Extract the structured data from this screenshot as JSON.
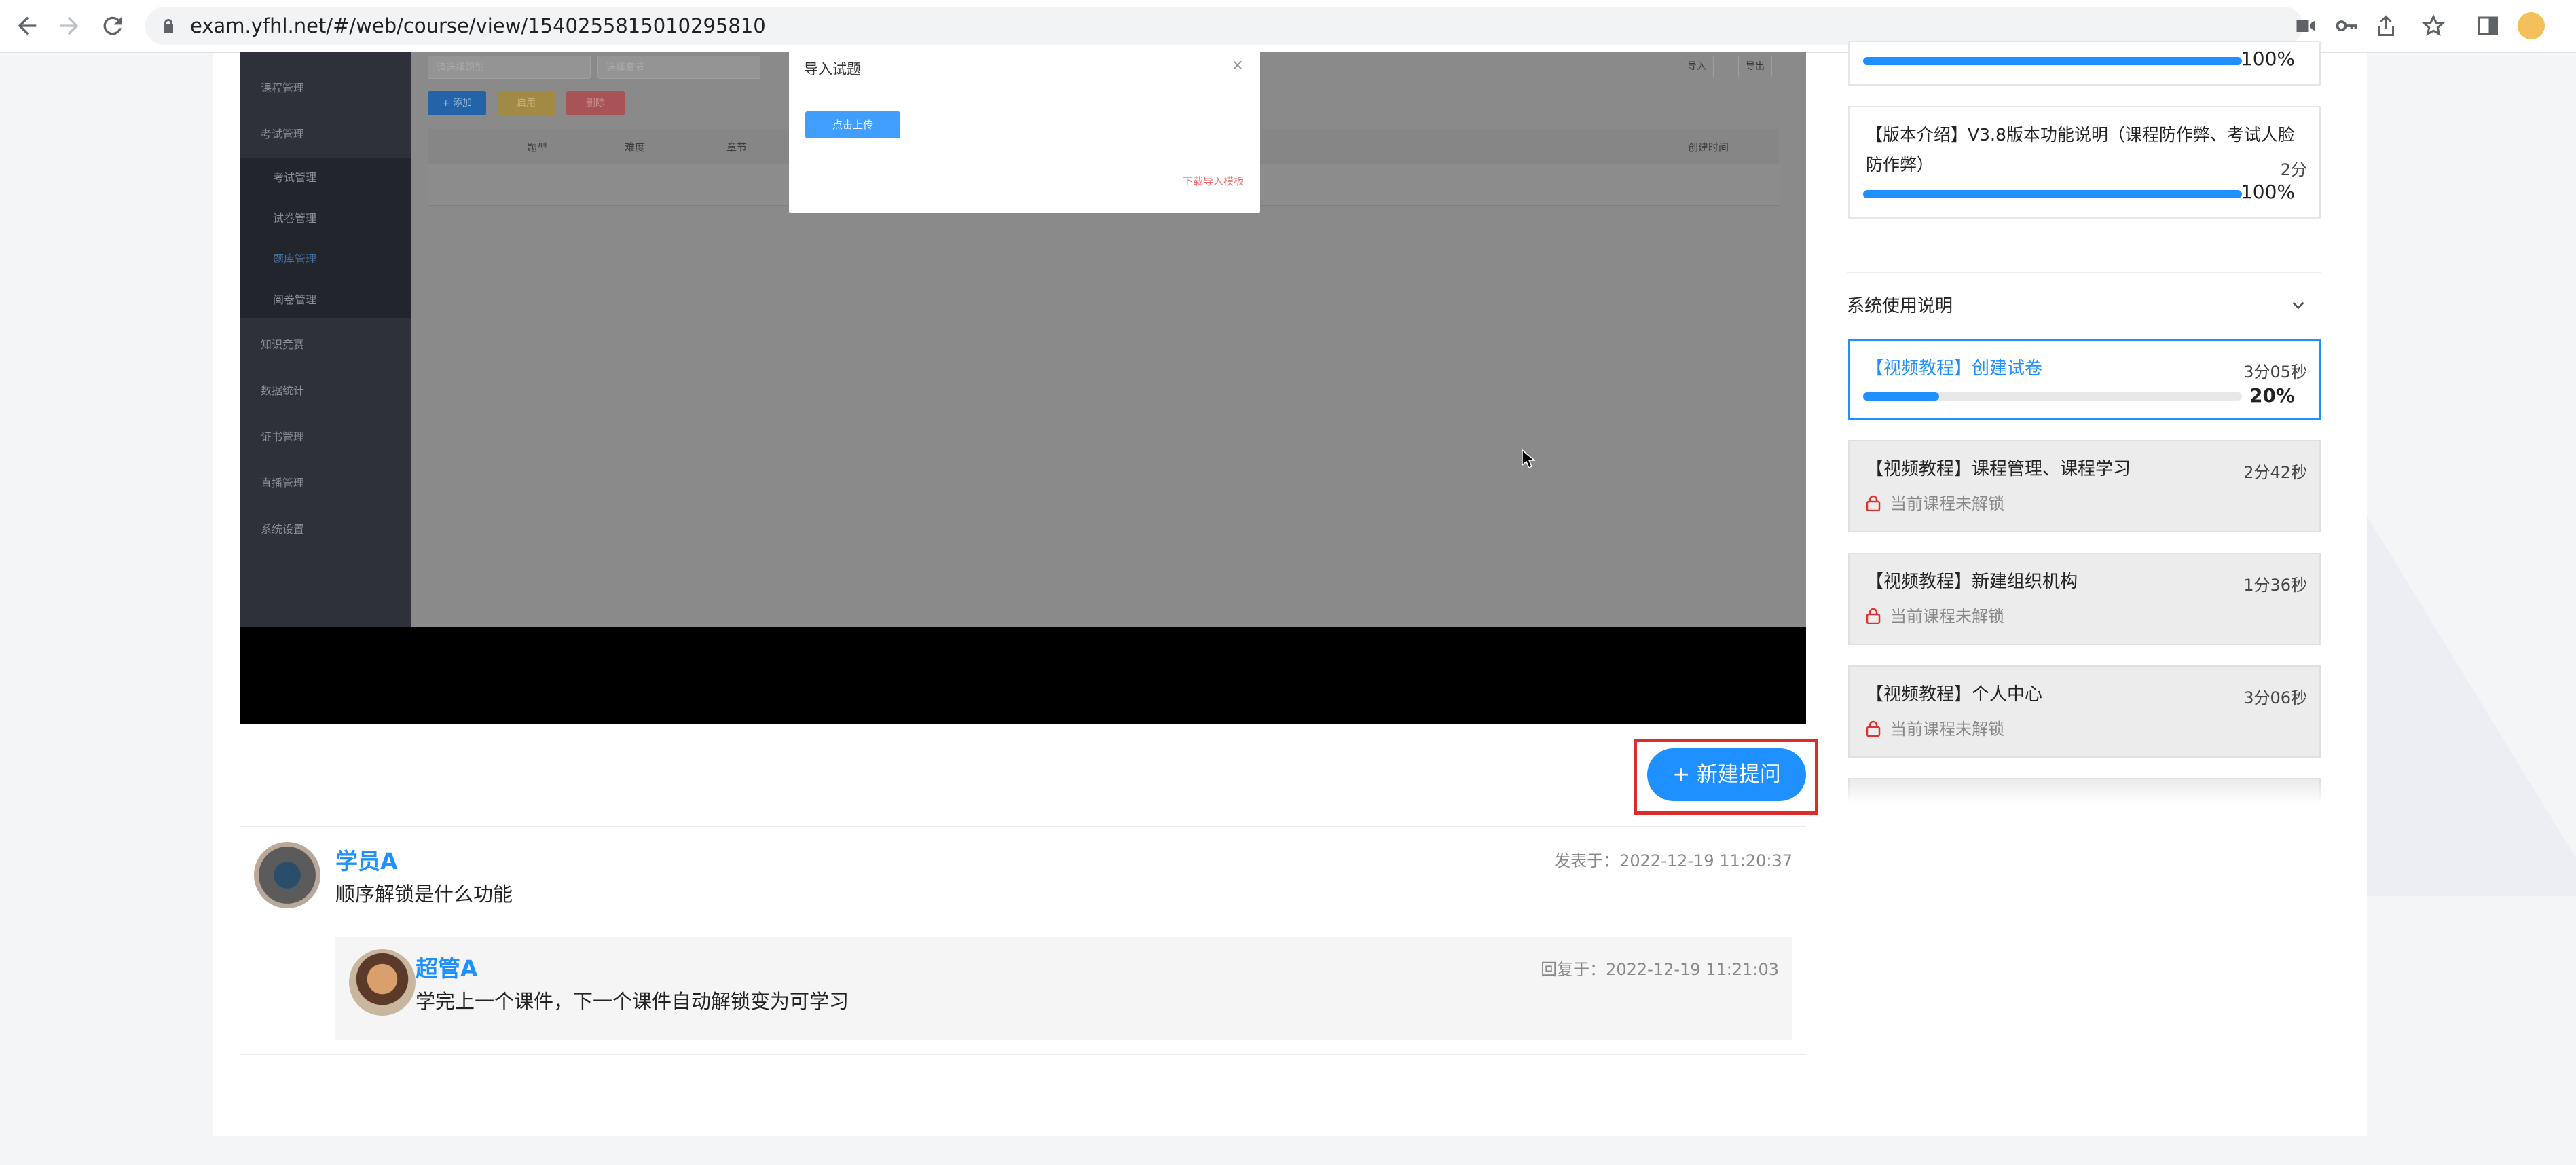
{
  "browser": {
    "url": "exam.yfhl.net/#/web/course/view/1540255815010295810"
  },
  "video": {
    "sidebar": {
      "items": [
        "课程管理",
        "考试管理",
        "知识竞赛",
        "数据统计",
        "证书管理",
        "直播管理",
        "系统设置"
      ],
      "subitems": [
        "考试管理",
        "试卷管理",
        "题库管理",
        "阅卷管理"
      ]
    },
    "toolbar": {
      "input1_placeholder": "请选择题型",
      "input2_placeholder": "选择章节",
      "add": "+ 添加",
      "btn2": "启用",
      "btn3": "删除",
      "import": "导入",
      "export": "导出"
    },
    "table": {
      "cols": [
        "题型",
        "难度",
        "章节",
        "创建时间"
      ]
    },
    "modal": {
      "title": "导入试题",
      "upload": "点击上传",
      "download": "下载导入模板",
      "close": "×"
    }
  },
  "ask": {
    "label": "+ 新建提问"
  },
  "question": {
    "author": "学员A",
    "text": "顺序解锁是什么功能",
    "time": "发表于：2022-12-19 11:20:37",
    "reply": {
      "author": "超管A",
      "text": "学完上一个课件，下一个课件自动解锁变为可学习",
      "time": "回复于：2022-12-19 11:21:03"
    }
  },
  "right": {
    "top_card": {
      "pct": "100%",
      "progress": 1.0
    },
    "intro_card": {
      "line1": "【版本介绍】V3.8版本功能说明（课程防作弊、考试人脸",
      "line2": "防作弊）",
      "duration": "2分",
      "pct": "100%",
      "progress": 1.0
    },
    "section_title": "系统使用说明",
    "lessons": [
      {
        "title": "【视频教程】创建试卷",
        "duration": "3分05秒",
        "pct": "20%",
        "progress": 0.2,
        "active": true
      },
      {
        "title": "【视频教程】课程管理、课程学习",
        "duration": "2分42秒",
        "lock_text": "当前课程未解锁"
      },
      {
        "title": "【视频教程】新建组织机构",
        "duration": "1分36秒",
        "lock_text": "当前课程未解锁"
      },
      {
        "title": "【视频教程】个人中心",
        "duration": "3分06秒",
        "lock_text": "当前课程未解锁"
      }
    ]
  }
}
